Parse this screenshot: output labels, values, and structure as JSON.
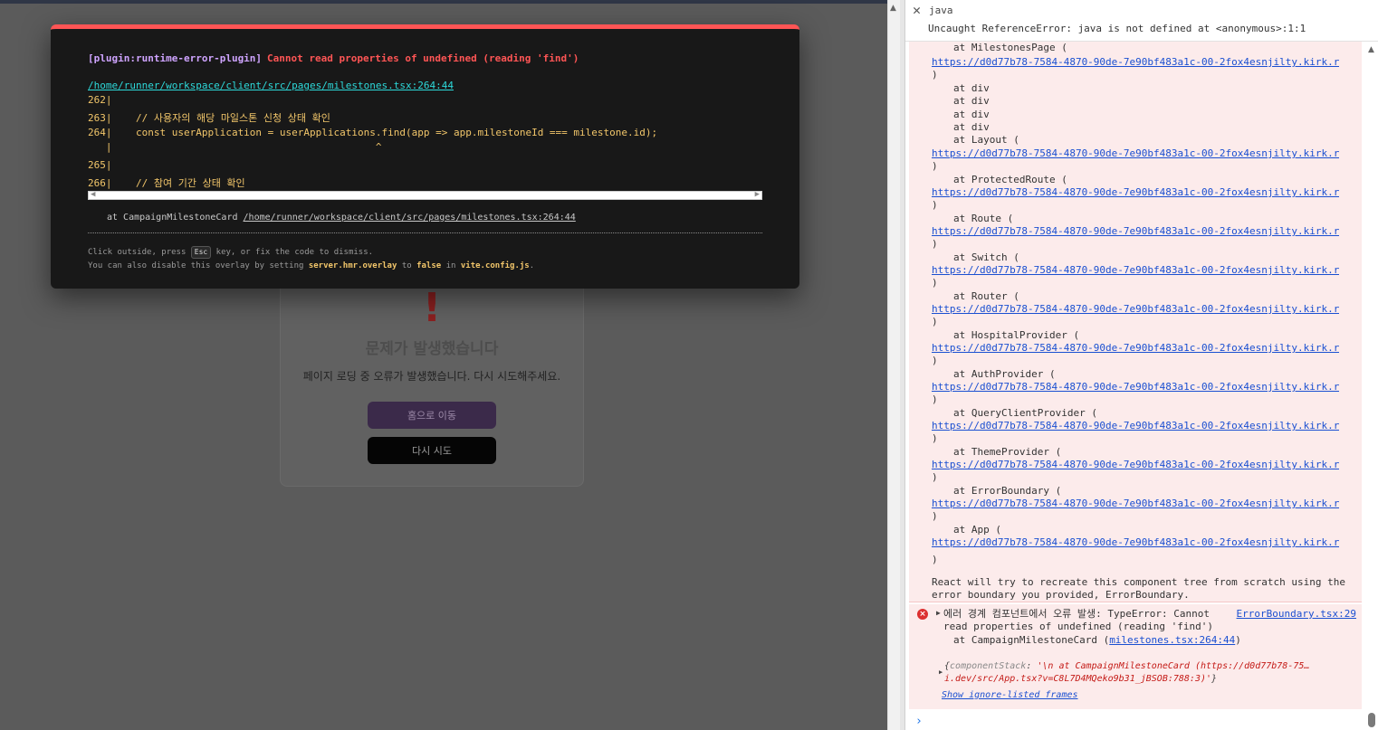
{
  "page": {
    "error_card": {
      "icon_glyph": "!",
      "title": "문제가 발생했습니다",
      "description": "페이지 로딩 중 오류가 발생했습니다. 다시 시도해주세요.",
      "home_button": "홈으로 이동",
      "retry_button": "다시 시도"
    },
    "overlay": {
      "plugin": "[plugin:runtime-error-plugin]",
      "message": "Cannot read properties of undefined (reading 'find')",
      "file": "/home/runner/workspace/client/src/pages/milestones.tsx:264:44",
      "code_lines": [
        "262|",
        "263|    // 사용자의 해당 마일스톤 신청 상태 확인",
        "264|    const userApplication = userApplications.find(app => app.milestoneId === milestone.id);",
        "   |                                            ^",
        "265|",
        "266|    // 참여 기간 상태 확인"
      ],
      "stack_prefix": "at CampaignMilestoneCard",
      "stack_file": "/home/runner/workspace/client/src/pages/milestones.tsx:264:44",
      "tip1_before": "Click outside, press",
      "tip1_key": "Esc",
      "tip1_after": "key, or fix the code to dismiss.",
      "tip2_a": "You can also disable this overlay by setting",
      "tip2_b": "server.hmr.overlay",
      "tip2_c": "to",
      "tip2_d": "false",
      "tip2_e": "in",
      "tip2_f": "vite.config.js",
      "tip2_g": "."
    }
  },
  "devtools": {
    "filter_value": "java",
    "reference_error": "Uncaught ReferenceError: java is not defined at <anonymous>:1:1",
    "stack_url": "https://d0d77b78-7584-4870-90de-7e90bf483a1c-00-2fox4esnjilty.kirk.replit…",
    "stack_close": ")",
    "stack": [
      {
        "kind": "at",
        "text": "at MilestonesPage ("
      },
      {
        "kind": "link"
      },
      {
        "kind": "close"
      },
      {
        "kind": "at",
        "text": "at div"
      },
      {
        "kind": "at",
        "text": "at div"
      },
      {
        "kind": "at",
        "text": "at div"
      },
      {
        "kind": "at",
        "text": "at div"
      },
      {
        "kind": "at",
        "text": "at Layout ("
      },
      {
        "kind": "link"
      },
      {
        "kind": "close"
      },
      {
        "kind": "at",
        "text": "at ProtectedRoute ("
      },
      {
        "kind": "link"
      },
      {
        "kind": "close"
      },
      {
        "kind": "at",
        "text": "at Route ("
      },
      {
        "kind": "link"
      },
      {
        "kind": "close"
      },
      {
        "kind": "at",
        "text": "at Switch ("
      },
      {
        "kind": "link"
      },
      {
        "kind": "close"
      },
      {
        "kind": "at",
        "text": "at Router ("
      },
      {
        "kind": "link"
      },
      {
        "kind": "close"
      },
      {
        "kind": "at",
        "text": "at HospitalProvider ("
      },
      {
        "kind": "link"
      },
      {
        "kind": "close"
      },
      {
        "kind": "at",
        "text": "at AuthProvider ("
      },
      {
        "kind": "link"
      },
      {
        "kind": "close"
      },
      {
        "kind": "at",
        "text": "at QueryClientProvider ("
      },
      {
        "kind": "link"
      },
      {
        "kind": "close"
      },
      {
        "kind": "at",
        "text": "at ThemeProvider ("
      },
      {
        "kind": "link"
      },
      {
        "kind": "close"
      },
      {
        "kind": "at",
        "text": "at ErrorBoundary ("
      },
      {
        "kind": "link"
      },
      {
        "kind": "close"
      },
      {
        "kind": "at",
        "text": "at App ("
      },
      {
        "kind": "link"
      },
      {
        "kind": "close"
      }
    ],
    "react_note": "React will try to recreate this component tree from scratch using the error boundary you provided, ErrorBoundary.",
    "error2": {
      "icon": "×",
      "text": "에러 경계 컴포넌트에서 오류 발생: TypeError: Cannot read properties of undefined (reading 'find')",
      "source": "ErrorBoundary.tsx:29",
      "at_prefix": "at CampaignMilestoneCard (",
      "at_link": "milestones.tsx:264:44",
      "at_suffix": ")",
      "obj_open": "{",
      "obj_key": "componentStack",
      "obj_sep": ": ",
      "obj_value": "'\\n    at CampaignMilestoneCard (https://d0d77b78-75…i.dev/src/App.tsx?v=C8L7D4MQeko9b31_jBSOB:788:3)'",
      "obj_close": "}",
      "show_frames": "Show ignore-listed frames"
    },
    "prompt_glyph": "›"
  },
  "colors": {
    "overlay_accent": "#ff5555",
    "plugin_purple": "#cfa4ff",
    "file_cyan": "#2dd9da",
    "code_yellow": "#f2c66a",
    "console_error_bg": "#fcebeb",
    "link_blue": "#1a4fd1"
  }
}
